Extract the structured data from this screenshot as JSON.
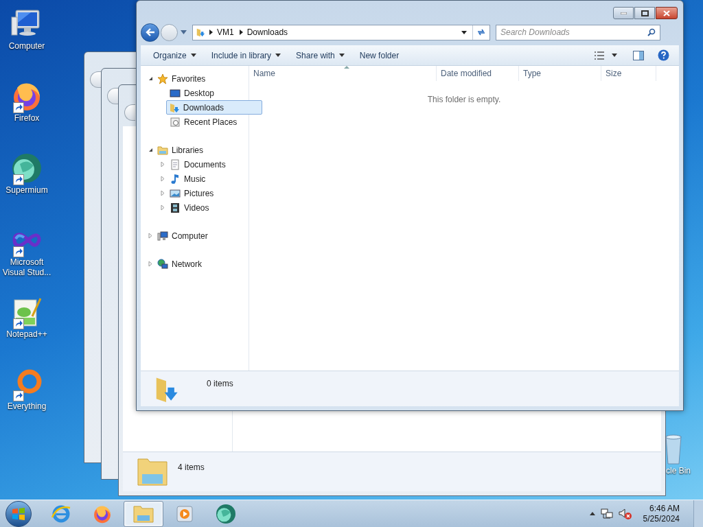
{
  "desktop_icons": [
    {
      "label": "Computer",
      "kind": "computer",
      "shortcut": false
    },
    {
      "label": "Firefox",
      "kind": "firefox",
      "shortcut": true
    },
    {
      "label": "Supermium",
      "kind": "supermium",
      "shortcut": true
    },
    {
      "label": "Microsoft Visual Stud...",
      "kind": "visualstudio",
      "shortcut": true
    },
    {
      "label": "Notepad++",
      "kind": "notepad",
      "shortcut": true
    },
    {
      "label": "Everything",
      "kind": "everything",
      "shortcut": true
    }
  ],
  "recycle_bin": {
    "label": "cle Bin"
  },
  "back_window": {
    "status_text": "4 items"
  },
  "explorer": {
    "breadcrumbs": [
      "VM1",
      "Downloads"
    ],
    "search": {
      "placeholder": "Search Downloads"
    },
    "toolbar": [
      {
        "label": "Organize",
        "has_menu": true
      },
      {
        "label": "Include in library",
        "has_menu": true
      },
      {
        "label": "Share with",
        "has_menu": true
      },
      {
        "label": "New folder",
        "has_menu": false
      }
    ],
    "nav_tree": [
      {
        "label": "Favorites",
        "kind": "star",
        "expanded": true,
        "selected": false,
        "children": [
          {
            "label": "Desktop",
            "kind": "desktop",
            "selected": false
          },
          {
            "label": "Downloads",
            "kind": "downloads",
            "selected": true
          },
          {
            "label": "Recent Places",
            "kind": "recent",
            "selected": false
          }
        ]
      },
      {
        "label": "Libraries",
        "kind": "libraries",
        "expanded": true,
        "selected": false,
        "children": [
          {
            "label": "Documents",
            "kind": "documents",
            "expanded": false,
            "selected": false
          },
          {
            "label": "Music",
            "kind": "music",
            "expanded": false,
            "selected": false
          },
          {
            "label": "Pictures",
            "kind": "pictures",
            "expanded": false,
            "selected": false
          },
          {
            "label": "Videos",
            "kind": "videos",
            "expanded": false,
            "selected": false
          }
        ]
      },
      {
        "label": "Computer",
        "kind": "computer",
        "expanded": false,
        "selected": false
      },
      {
        "label": "Network",
        "kind": "network",
        "expanded": false,
        "selected": false
      }
    ],
    "columns": [
      "Name",
      "Date modified",
      "Type",
      "Size"
    ],
    "empty_message": "This folder is empty.",
    "status_text": "0 items"
  },
  "taskbar": {
    "apps": [
      {
        "kind": "ie",
        "selected": false
      },
      {
        "kind": "firefox",
        "selected": false
      },
      {
        "kind": "explorer",
        "selected": true
      },
      {
        "kind": "media",
        "selected": false
      },
      {
        "kind": "supermium",
        "selected": false
      }
    ],
    "time": "6:46 AM",
    "date": "5/25/2024"
  }
}
